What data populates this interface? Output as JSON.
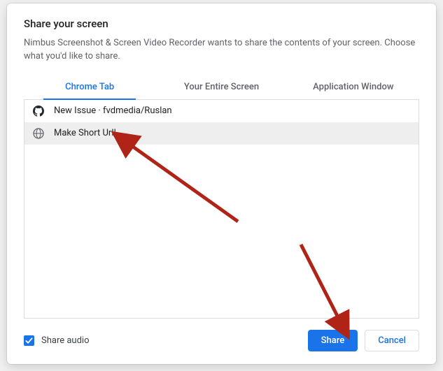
{
  "dialog": {
    "title": "Share your screen",
    "subtext": "Nimbus Screenshot & Screen Video Recorder wants to share the contents of your screen. Choose what you'd like to share."
  },
  "tabs": {
    "chrome": "Chrome Tab",
    "entire": "Your Entire Screen",
    "appwin": "Application Window"
  },
  "items": [
    {
      "icon": "github",
      "label": "New Issue · fvdmedia/Ruslan"
    },
    {
      "icon": "globe",
      "label": "Make Short Url!"
    }
  ],
  "footer": {
    "share_audio_label": "Share audio",
    "share_button": "Share",
    "cancel_button": "Cancel"
  },
  "colors": {
    "accent": "#1a73e8",
    "arrow": "#b02418"
  }
}
